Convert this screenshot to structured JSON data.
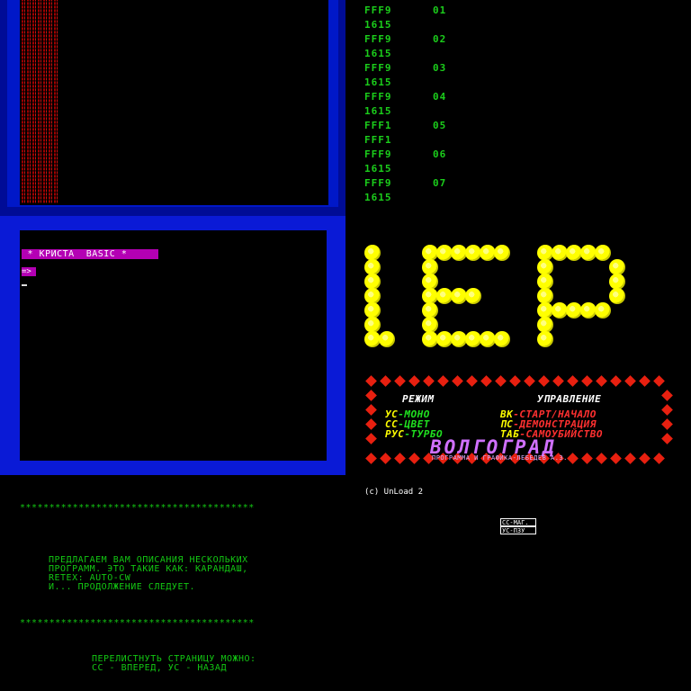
{
  "hex_dump": [
    {
      "addr": "FFF9",
      "val": "01"
    },
    {
      "addr": "1615",
      "val": ""
    },
    {
      "addr": "FFF9",
      "val": "02"
    },
    {
      "addr": "1615",
      "val": ""
    },
    {
      "addr": "FFF9",
      "val": "03"
    },
    {
      "addr": "1615",
      "val": ""
    },
    {
      "addr": "FFF9",
      "val": "04"
    },
    {
      "addr": "1615",
      "val": ""
    },
    {
      "addr": "FFF1",
      "val": "05"
    },
    {
      "addr": "FFF1",
      "val": ""
    },
    {
      "addr": "FFF9",
      "val": "06"
    },
    {
      "addr": "1615",
      "val": ""
    },
    {
      "addr": "FFF9",
      "val": "07"
    },
    {
      "addr": "1615",
      "val": ""
    }
  ],
  "krista": {
    "title": " * КРИСТА  BASIC *",
    "prompt": "=>",
    "cursor": "_"
  },
  "info": {
    "stars": "****************************************",
    "para1": "ПРЕДЛАГАЕМ ВАМ ОПИСАНИЯ НЕСКОЛЬКИХ\nПРОГРАММ. ЭТО ТАКИЕ КАК: КАРАНДАШ,\nRETEX: AUTO-CW\nИ... ПРОДОЛЖЕНИЕ СЛЕДУЕТ.",
    "para2": "ПЕРЕЛИСТНУТЬ СТРАНИЦУ МОЖНО:\nСС - ВПЕРЕД, УС - НАЗАД"
  },
  "game": {
    "logo": "ЧЕР",
    "mode_header": "РЕЖИМ",
    "control_header": "УПРАВЛЕНИЕ",
    "mode_items": [
      {
        "key": "УС",
        "label": "-МОНО"
      },
      {
        "key": "СС",
        "label": "-ЦВЕТ"
      },
      {
        "key": "РУС",
        "label": "-ТУРБО"
      }
    ],
    "control_items": [
      {
        "key": "ВК",
        "label": "-СТАРТ/НАЧАЛО"
      },
      {
        "key": "ПС",
        "label": "-ДЕМОНСТРАЦИЯ"
      },
      {
        "key": "ТАБ",
        "label": "-САМОУБИЙСТВО"
      }
    ],
    "city": "ВОЛГОГРАД",
    "credit": "ПРОГРАММА И ГРАФИКА-ЛЕБЕДЕВ А.З.",
    "unload": "(c)  UnLoad 2",
    "key1": "СС-МАГ.",
    "key2": "УС-ПЗУ",
    "colors": {
      "key": "#ffff00",
      "label_green": "#20e020",
      "label_red": "#ff3030",
      "header": "#ffffff"
    }
  }
}
